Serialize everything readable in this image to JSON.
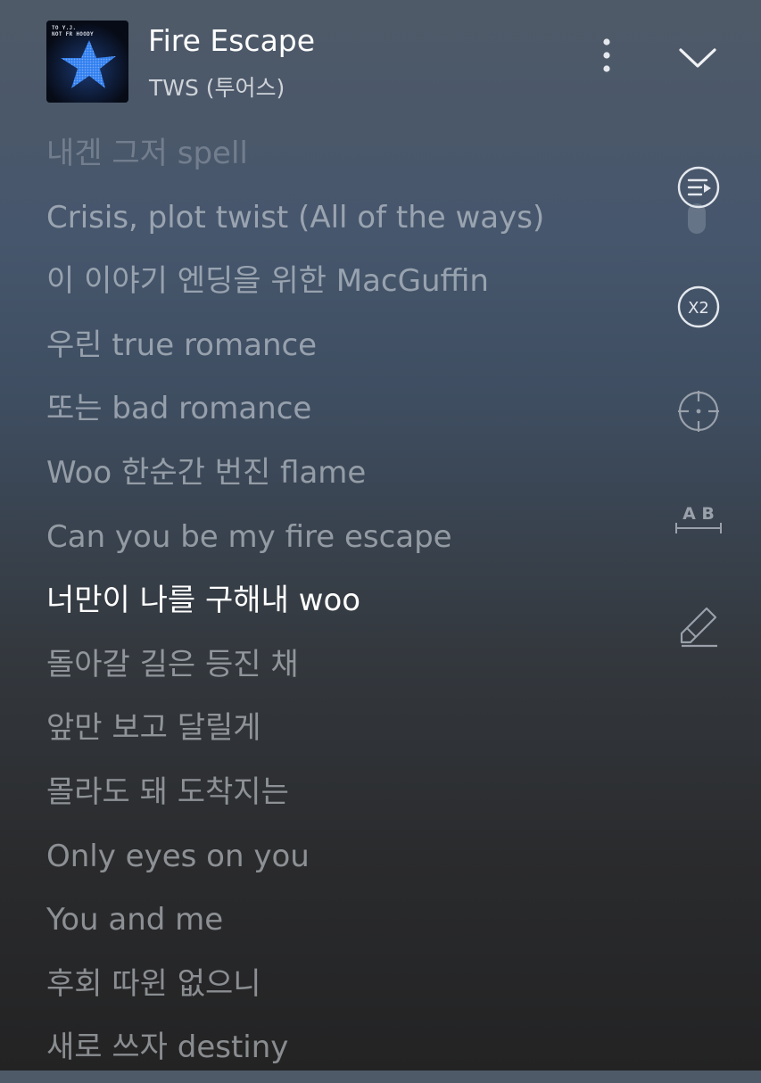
{
  "track": {
    "title": "Fire Escape",
    "artist": "TWS (투어스)",
    "album_art_lines": [
      "TO Y.J.",
      "NOT FR HOODY"
    ]
  },
  "icons": {
    "more": "more-vertical-icon",
    "collapse": "chevron-down-icon",
    "autoscroll": "autoscroll-icon",
    "speed": "speed-x2-icon",
    "sync": "crosshair-icon",
    "ab_repeat": "ab-repeat-icon",
    "edit": "edit-pen-icon"
  },
  "tools": {
    "speed_label": "X2",
    "ab_label": "A B"
  },
  "lyrics": [
    "내겐 그저 spell",
    "Crisis, plot twist (All of the ways)",
    "이 이야기 엔딩을 위한 MacGuffin",
    "우린 true romance",
    "또는 bad romance",
    "Woo 한순간 번진 flame",
    "Can you be my fire escape",
    "너만이 나를 구해내 woo",
    "돌아갈 길은 등진 채",
    "앞만 보고 달릴게",
    "몰라도 돼 도착지는",
    "Only eyes on you",
    "You and me",
    "후회 따윈 없으니",
    "새로 쓰자 destiny"
  ],
  "current_line_index": 7,
  "colors": {
    "text_current": "#ffffff",
    "text_dim": "#dee3e9",
    "accent_star": "#2f7ef0",
    "icon": "#e4e8ee"
  }
}
